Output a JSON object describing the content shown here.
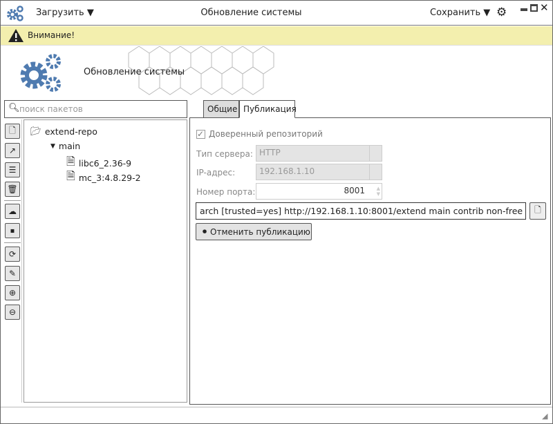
{
  "titlebar": {
    "load_label": "Загрузить",
    "title": "Обновление системы",
    "save_label": "Сохранить"
  },
  "warning": {
    "text": "Внимание!"
  },
  "banner": {
    "title": "Обновление системы"
  },
  "search": {
    "placeholder": "поиск пакетов"
  },
  "tabs": [
    {
      "label": "Общие"
    },
    {
      "label": "Публикация"
    }
  ],
  "tree": {
    "root": "extend-repo",
    "branch": "main",
    "items": [
      "libc6_2.36-9",
      "mc_3:4.8.29-2"
    ]
  },
  "form": {
    "trusted_label": "Доверенный репозиторий",
    "trusted": true,
    "server_type_label": "Тип сервера:",
    "server_type": "HTTP",
    "ip_label": "IP-адрес:",
    "ip": "192.168.1.10",
    "port_label": "Номер порта:",
    "port": "8001",
    "source_line": "arch [trusted=yes] http://192.168.1.10:8001/extend main contrib non-free",
    "unpublish_label": "Отменить публикацию"
  },
  "colors": {
    "accent": "#4f7bb0",
    "warning_bg": "#f3efae"
  }
}
